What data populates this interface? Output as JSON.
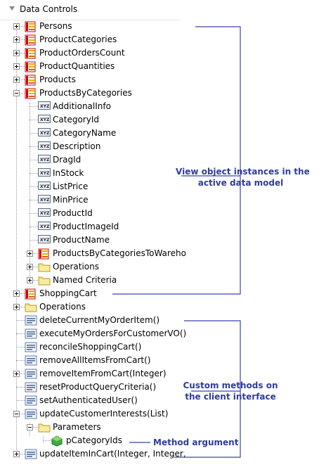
{
  "panel": {
    "title": "Data Controls"
  },
  "tree": {
    "persons": "Persons",
    "product_categories": "ProductCategories",
    "product_orders_count": "ProductOrdersCount",
    "product_quantities": "ProductQuantities",
    "products": "Products",
    "products_by_categories": "ProductsByCategories",
    "attributes": [
      "AdditionalInfo",
      "CategoryId",
      "CategoryName",
      "Description",
      "DragId",
      "InStock",
      "ListPrice",
      "MinPrice",
      "ProductId",
      "ProductImageId",
      "ProductName"
    ],
    "child_products_to_warehouse": "ProductsByCategoriesToWareho",
    "child_operations": "Operations",
    "child_named_criteria": "Named Criteria",
    "shopping_cart": "ShoppingCart",
    "operations": "Operations",
    "methods": [
      "deleteCurrentMyOrderItem()",
      "executeMyOrdersForCustomerVO()",
      "reconcileShoppingCart()",
      "removeAllItemsFromCart()",
      "removeItemFromCart(Integer)",
      "resetProductQueryCriteria()",
      "setAuthenticatedUser()",
      "updateCustomerInterests(List)"
    ],
    "parameters": "Parameters",
    "param_category_ids": "pCategoryIds",
    "method_update_item_in_cart": "updateItemInCart(Integer, Integer,"
  },
  "callouts": {
    "view_objects": [
      "View object instances in the",
      "active data model"
    ],
    "custom_methods": [
      "Custom methods on",
      "the client interface"
    ],
    "method_argument": "Method argument"
  },
  "colors": {
    "callout_text": "#2f3c9c",
    "callout_line": "#3b44a8"
  }
}
